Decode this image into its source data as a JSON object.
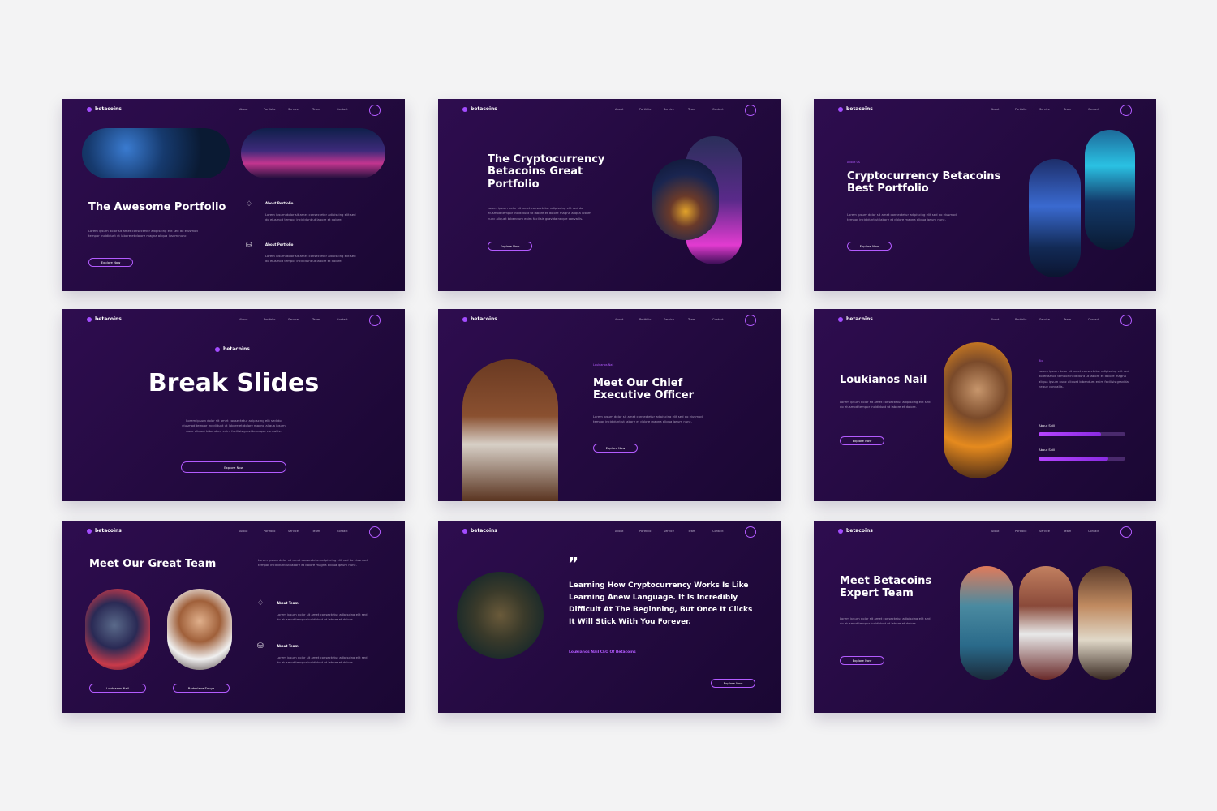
{
  "brand": {
    "name": "betacoins",
    "accent": "#b35bff",
    "background": "#2a0c48"
  },
  "nav": [
    "About",
    "Portfolio",
    "Service",
    "Team",
    "Contact"
  ],
  "lorem": {
    "short": "Lorem ipsum dolor sit amet consectetur adipiscing elit sed do eiusmod\ntempor incididunt ut labore et dolore magna aliqua ipsum nunc.",
    "mid": "Lorem ipsum dolor sit amet consectetur adipiscing elit sed do\neiusmod tempor incididunt ut labore et dolore magna aliqua ipsum\nnunc aliquet bibendum enim facilisis gravida neque convallis.",
    "small": "Lorem ipsum dolor sit amet consectetur adipiscing elit sed\ndo eiusmod tempor incididunt ut labore et dolore."
  },
  "slides": {
    "s1": {
      "title": "The Awesome Portfolio",
      "feat1": "About Portfolio",
      "feat2": "About Portfolio",
      "button": "Explore Now"
    },
    "s2": {
      "title": "The Cryptocurrency\nBetacoins Great\nPortfolio",
      "button": "Explore Now"
    },
    "s3": {
      "kicker": "About Us",
      "title": "Cryptocurrency Betacoins\nBest Portfolio",
      "button": "Explore Now"
    },
    "s4": {
      "title": "Break Slides",
      "button": "Explore Now"
    },
    "s5": {
      "kicker": "Loukianos Nail",
      "title": "Meet Our Chief\nExecutive Officer",
      "button": "Explore Now"
    },
    "s6": {
      "title": "Loukianos Nail",
      "bio_label": "Bio",
      "skill1": "About Skill",
      "skill2": "About Skill",
      "skill1_pct": 0.72,
      "skill2_pct": 0.8,
      "button": "Explore Now"
    },
    "s7": {
      "title": "Meet Our Great Team",
      "feat1": "About Team",
      "feat2": "About Team",
      "member1": "Loukianos Nail",
      "member2": "Radoslava Sonya"
    },
    "s8": {
      "quote_mark": "”",
      "quote": "Learning How Cryptocurrency Works Is Like\nLearning Anew Language. It Is Incredibly\nDifficult At The Beginning, But Once It Clicks\nIt Will Stick With You Forever.",
      "author": "Loukianos Nail CEO Of Betacoins",
      "button": "Explore Now"
    },
    "s9": {
      "title": "Meet Betacoins\nExpert Team",
      "button": "Explore Now"
    }
  },
  "icons": {
    "diamond": "diamond-icon",
    "coins": "coins-icon",
    "quote": "quote-icon",
    "ring": "ring-icon"
  }
}
